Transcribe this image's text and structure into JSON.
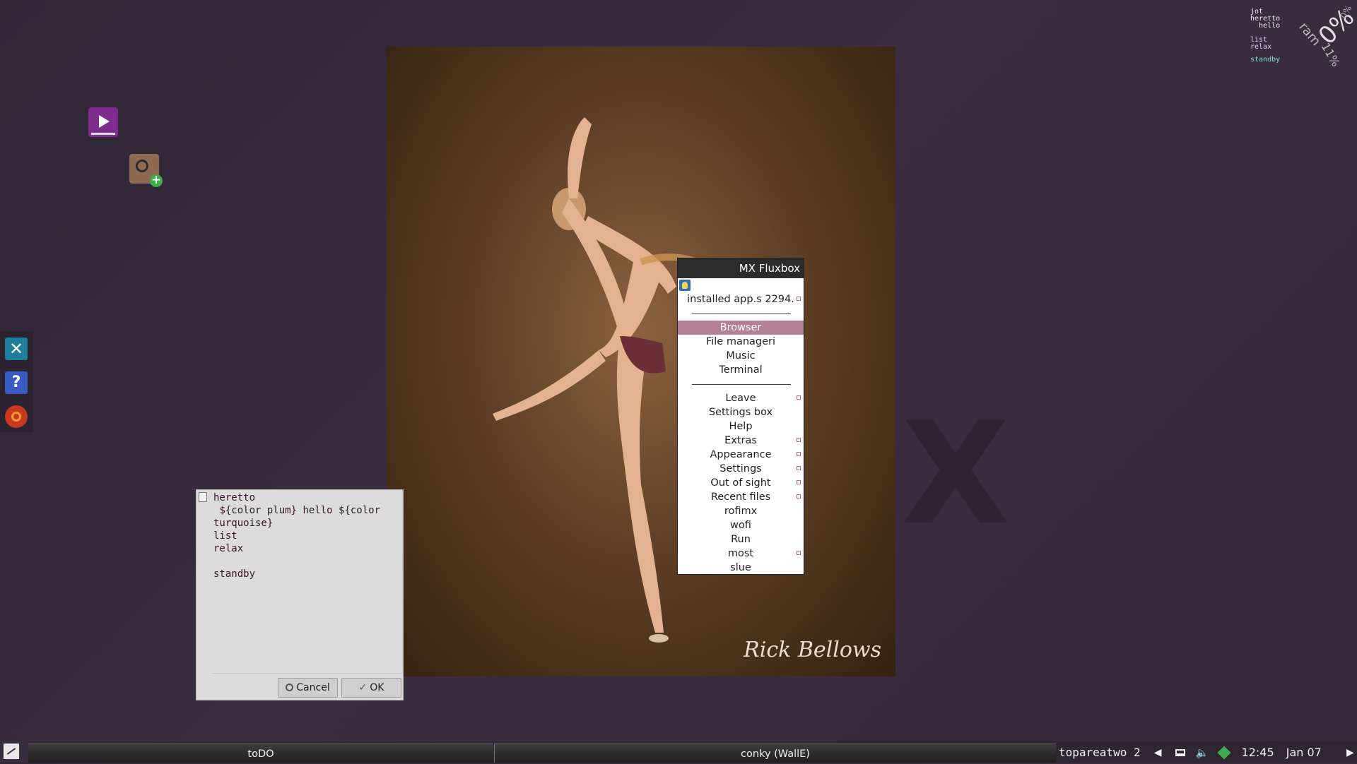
{
  "menu": {
    "title": "MX Fluxbox",
    "items": [
      {
        "label": "installed app.s 2294.",
        "submenu": true
      },
      {
        "label": "Browser",
        "selected": true
      },
      {
        "label": "File manageri"
      },
      {
        "label": "Music"
      },
      {
        "label": "Terminal"
      },
      {
        "label": "Leave",
        "submenu": true
      },
      {
        "label": "Settings box"
      },
      {
        "label": "Help"
      },
      {
        "label": "Extras",
        "submenu": true
      },
      {
        "label": "Appearance",
        "submenu": true
      },
      {
        "label": "Settings",
        "submenu": true
      },
      {
        "label": "Out of sight",
        "submenu": true
      },
      {
        "label": "Recent files",
        "submenu": true
      },
      {
        "label": "rofimx"
      },
      {
        "label": "wofi"
      },
      {
        "label": "Run"
      },
      {
        "label": "most",
        "submenu": true
      },
      {
        "label": "slue"
      }
    ],
    "accent_color": "#b47f98"
  },
  "dialog": {
    "text": "heretto\n ${color plum} hello ${color turquoise}\nlist\nrelax\n\nstandby",
    "cancel_label": "Cancel",
    "ok_label": "OK"
  },
  "conky": {
    "line1": "jot\nheretto\n  hello",
    "line2": "list\nrelax",
    "line3": "standby",
    "cpu_pct": "0%",
    "ram_label": "ram",
    "ram_value": "11%",
    "small": "0%"
  },
  "taskbar": {
    "tasks": [
      "toDO",
      "conky (WallE)"
    ],
    "workspace": "topareatwo 2",
    "time": "12:45",
    "date": "Jan 07"
  },
  "desktop": {
    "icons": [
      "video-player-icon",
      "app-installer-icon"
    ],
    "dock_icons": [
      "tools-icon",
      "help-icon",
      "settings-wheel-icon"
    ]
  },
  "wallpaper": {
    "signature": "Rick Bellows"
  }
}
